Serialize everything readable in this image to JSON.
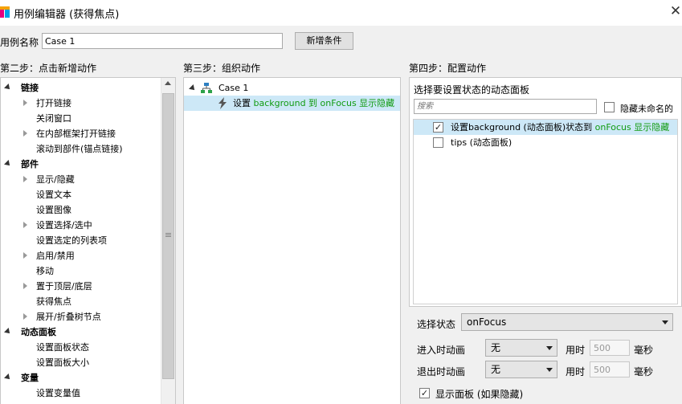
{
  "window": {
    "title": "用例编辑器 (获得焦点)"
  },
  "case": {
    "label": "用例名称",
    "value": "Case 1",
    "add_condition_label": "新增条件"
  },
  "steps": {
    "step2": "第二步：点击新增动作",
    "step3": "第三步：组织动作",
    "step4": "第四步：配置动作"
  },
  "actions_tree": [
    {
      "type": "category",
      "label": "链接"
    },
    {
      "type": "item",
      "label": "打开链接",
      "expandable": true
    },
    {
      "type": "item",
      "label": "关闭窗口",
      "expandable": false
    },
    {
      "type": "item",
      "label": "在内部框架打开链接",
      "expandable": true
    },
    {
      "type": "item",
      "label": "滚动到部件(锚点链接)",
      "expandable": false
    },
    {
      "type": "category",
      "label": "部件"
    },
    {
      "type": "item",
      "label": "显示/隐藏",
      "expandable": true
    },
    {
      "type": "item",
      "label": "设置文本",
      "expandable": false
    },
    {
      "type": "item",
      "label": "设置图像",
      "expandable": false
    },
    {
      "type": "item",
      "label": "设置选择/选中",
      "expandable": true
    },
    {
      "type": "item",
      "label": "设置选定的列表项",
      "expandable": false
    },
    {
      "type": "item",
      "label": "启用/禁用",
      "expandable": true
    },
    {
      "type": "item",
      "label": "移动",
      "expandable": false
    },
    {
      "type": "item",
      "label": "置于顶层/底层",
      "expandable": true
    },
    {
      "type": "item",
      "label": "获得焦点",
      "expandable": false
    },
    {
      "type": "item",
      "label": "展开/折叠树节点",
      "expandable": true
    },
    {
      "type": "category",
      "label": "动态面板"
    },
    {
      "type": "item",
      "label": "设置面板状态",
      "expandable": false
    },
    {
      "type": "item",
      "label": "设置面板大小",
      "expandable": false
    },
    {
      "type": "category",
      "label": "变量"
    },
    {
      "type": "item",
      "label": "设置变量值",
      "expandable": false
    }
  ],
  "organize": {
    "case_name": "Case 1",
    "action_prefix": "设置",
    "action_highlight": "background 到 onFocus 显示隐藏"
  },
  "config": {
    "panel_title": "选择要设置状态的动态面板",
    "search_placeholder": "搜索",
    "hide_unnamed_label": "隐藏未命名的",
    "hide_unnamed_checked": false,
    "panels": [
      {
        "checked": true,
        "label": "设置background (动态面板)状态到 ",
        "highlight": "onFocus 显示隐藏"
      },
      {
        "checked": false,
        "label": "tips (动态面板)",
        "highlight": ""
      }
    ],
    "state_label": "选择状态",
    "state_value": "onFocus",
    "enter_anim_label": "进入时动画",
    "enter_anim_value": "无",
    "exit_anim_label": "退出时动画",
    "exit_anim_value": "无",
    "duration_label": "用时",
    "enter_duration": "500",
    "exit_duration": "500",
    "ms_unit": "毫秒",
    "show_panel_label": "显示面板 (如果隐藏)",
    "show_panel_checked": true
  },
  "colors": {
    "highlight_text": "#119b11",
    "selection_bg": "#cde8f7"
  }
}
